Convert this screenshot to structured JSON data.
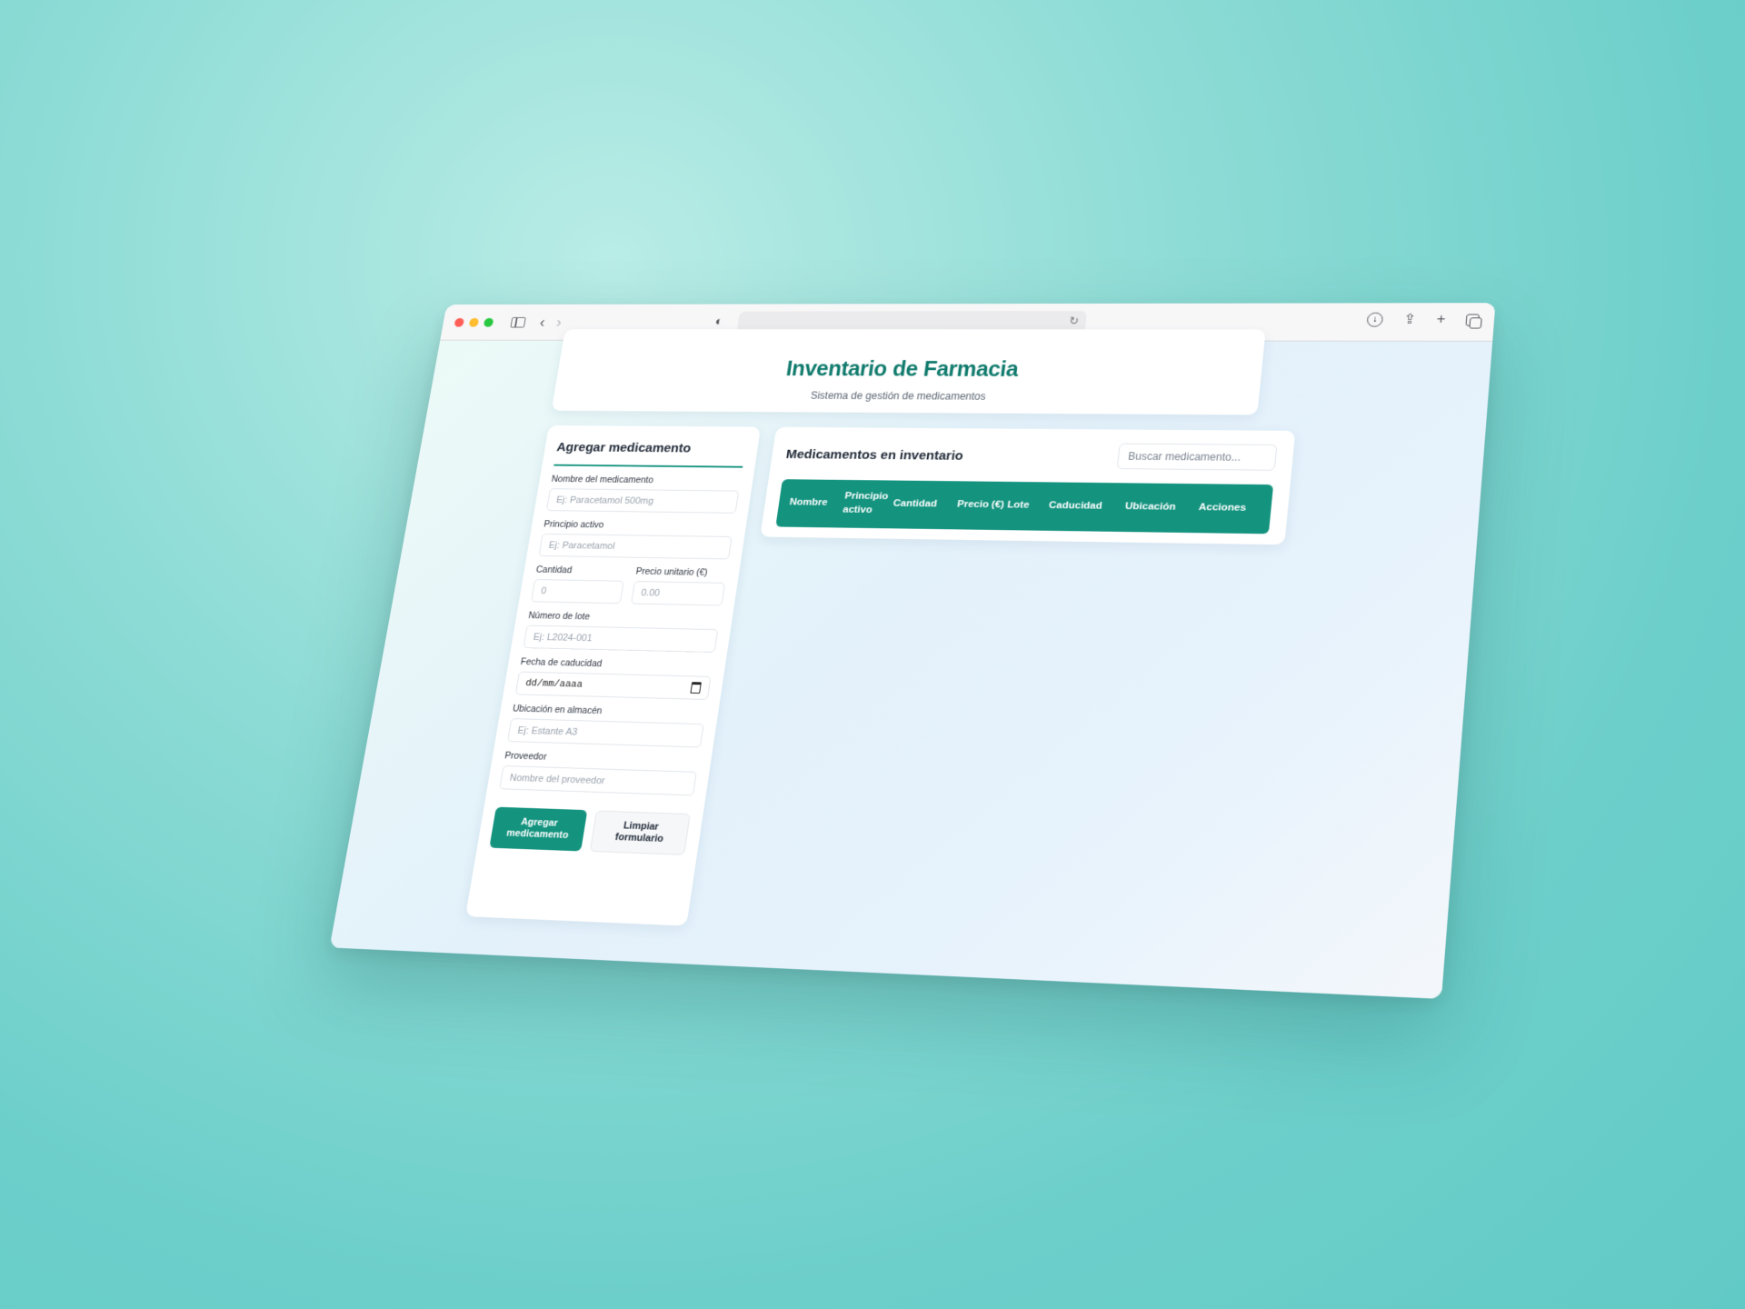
{
  "header": {
    "title": "Inventario de Farmacia",
    "subtitle": "Sistema de gestión de medicamentos"
  },
  "form": {
    "title": "Agregar medicamento",
    "fields": {
      "nombre": {
        "label": "Nombre del medicamento",
        "placeholder": "Ej: Paracetamol 500mg"
      },
      "principio": {
        "label": "Principio activo",
        "placeholder": "Ej: Paracetamol"
      },
      "cantidad": {
        "label": "Cantidad",
        "placeholder": "0"
      },
      "precio": {
        "label": "Precio unitario (€)",
        "placeholder": "0.00"
      },
      "lote": {
        "label": "Número de lote",
        "placeholder": "Ej: L2024-001"
      },
      "caducidad": {
        "label": "Fecha de caducidad",
        "value": "dd/mm/aaaa"
      },
      "ubicacion": {
        "label": "Ubicación en almacén",
        "placeholder": "Ej: Estante A3"
      },
      "proveedor": {
        "label": "Proveedor",
        "placeholder": "Nombre del proveedor"
      }
    },
    "submit_label": "Agregar medicamento",
    "clear_label": "Limpiar formulario"
  },
  "inventory": {
    "title": "Medicamentos en inventario",
    "search_placeholder": "Buscar medicamento...",
    "columns": [
      "Nombre",
      "Principio activo",
      "Cantidad",
      "Precio (€)",
      "Lote",
      "Caducidad",
      "Ubicación",
      "Acciones"
    ]
  },
  "colors": {
    "accent": "#14937f",
    "title": "#0f7a6c"
  }
}
